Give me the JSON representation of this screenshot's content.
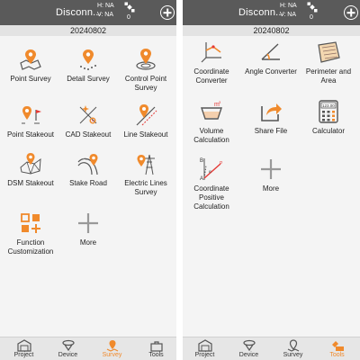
{
  "left": {
    "status": {
      "title": "Disconn...",
      "h": "H: NA",
      "v": "V: NA",
      "sats": "0"
    },
    "date": "20240802",
    "items": [
      {
        "label": "Point Survey",
        "icon": "map-pin-on-map-icon"
      },
      {
        "label": "Detail Survey",
        "icon": "pin-with-points-icon"
      },
      {
        "label": "Control Point Survey",
        "icon": "pin-on-target-icon"
      },
      {
        "label": "Point Stakeout",
        "icon": "pin-with-flag-icon"
      },
      {
        "label": "CAD Stakeout",
        "icon": "cad-crosshair-icon"
      },
      {
        "label": "Line Stakeout",
        "icon": "pin-on-line-icon"
      },
      {
        "label": "DSM Stakeout",
        "icon": "dsm-mesh-pin-icon"
      },
      {
        "label": "Stake Road",
        "icon": "road-pin-icon"
      },
      {
        "label": "Electric Lines Survey",
        "icon": "power-tower-pin-icon"
      },
      {
        "label": "Function Customization",
        "icon": "grid-plus-icon"
      },
      {
        "label": "More",
        "icon": "plus-icon"
      }
    ],
    "tabs": [
      {
        "label": "Project"
      },
      {
        "label": "Device"
      },
      {
        "label": "Survey"
      },
      {
        "label": "Tools"
      }
    ]
  },
  "right": {
    "status": {
      "title": "Disconn...",
      "h": "H: NA",
      "v": "V: NA",
      "sats": "0"
    },
    "date": "20240802",
    "items": [
      {
        "label": "Coordinate Converter",
        "icon": "coordinate-axes-icon"
      },
      {
        "label": "Angle Converter",
        "icon": "angle-icon"
      },
      {
        "label": "Perimeter and Area",
        "icon": "land-parcel-icon"
      },
      {
        "label": "Volume Calculation",
        "icon": "volume-basin-icon"
      },
      {
        "label": "Share File",
        "icon": "share-arrow-icon"
      },
      {
        "label": "Calculator",
        "icon": "calculator-icon"
      },
      {
        "label": "Coordinate Positive Calculation",
        "icon": "coordinate-calc-icon"
      },
      {
        "label": "More",
        "icon": "plus-icon"
      }
    ],
    "tabs": [
      {
        "label": "Project"
      },
      {
        "label": "Device"
      },
      {
        "label": "Survey"
      },
      {
        "label": "Tools"
      }
    ],
    "calc_display": "123.00"
  },
  "colors": {
    "accent": "#f08a2c",
    "bar": "#5a5a5a",
    "icon_gray": "#555555"
  }
}
